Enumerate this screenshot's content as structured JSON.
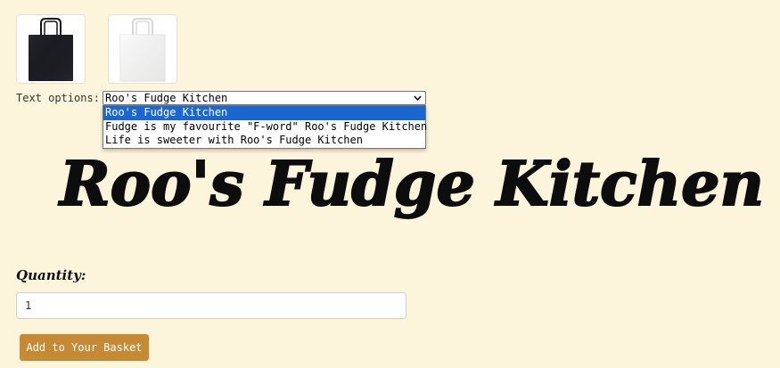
{
  "product": {
    "colour_swatches": [
      {
        "name": "black-tote",
        "color": "#1b1d22"
      },
      {
        "name": "white-tote",
        "color": "#f4f4f4"
      }
    ]
  },
  "text_options": {
    "label": "Text options:",
    "selected": "Roo's Fudge Kitchen",
    "options": [
      "Roo's Fudge Kitchen",
      "Fudge is my favourite \"F-word\" Roo's Fudge Kitchen",
      "Life is sweeter with Roo's Fudge Kitchen"
    ]
  },
  "preview": {
    "text": "Roo's Fudge Kitchen"
  },
  "quantity": {
    "label": "Quantity:",
    "value": "1"
  },
  "actions": {
    "add_label": "Add to Your Basket"
  },
  "colors": {
    "background": "#fdf4dc",
    "button": "#c68a34",
    "highlight": "#1967d2"
  }
}
